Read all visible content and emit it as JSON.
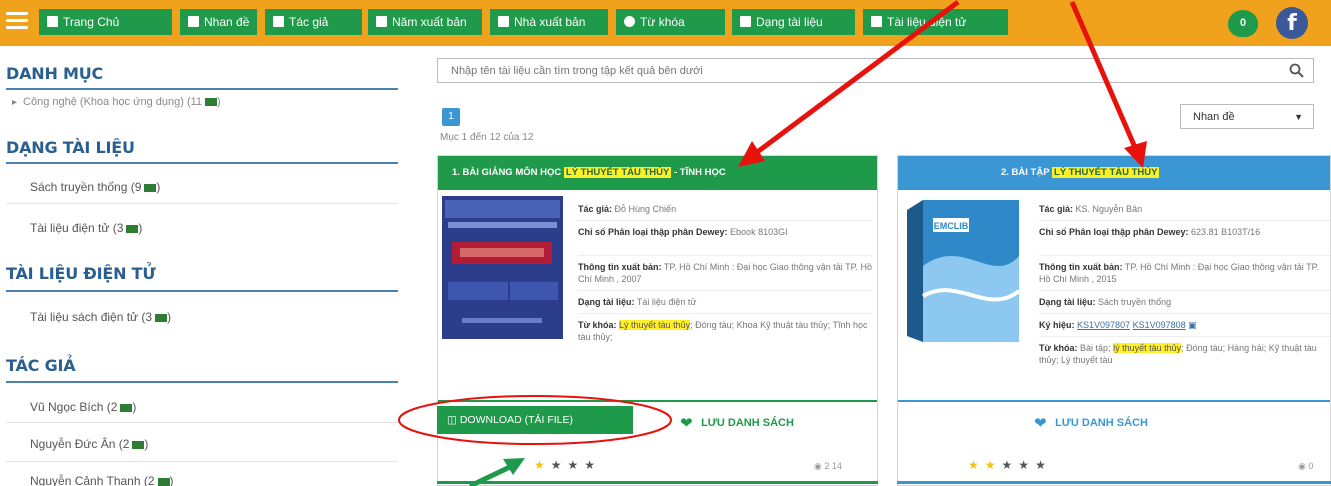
{
  "nav": {
    "items": [
      {
        "label": "Trang Chủ",
        "icon": "home-icon"
      },
      {
        "label": "Nhan đề",
        "icon": "title-icon"
      },
      {
        "label": "Tác giả",
        "icon": "author-icon"
      },
      {
        "label": "Năm xuất bản",
        "icon": "calendar-icon"
      },
      {
        "label": "Nhà xuất bản",
        "icon": "publisher-icon"
      },
      {
        "label": "Từ khóa",
        "icon": "tag-icon"
      },
      {
        "label": "Dạng tài liệu",
        "icon": "doc-type-icon"
      },
      {
        "label": "Tài liệu điện tử",
        "icon": "ebook-icon"
      }
    ],
    "favorites_count": "0",
    "facebook_label": "f"
  },
  "sidebar": {
    "danh_muc_title": "DANH MỤC",
    "danh_muc_item": "Công nghệ (Khoa học ứng dụng) (11",
    "dang_title": "DẠNG TÀI LIỆU",
    "dang_items": [
      "Sách truyền thống (9",
      "Tài liệu điện tử (3"
    ],
    "dien_tu_title": "TÀI LIỆU ĐIỆN TỬ",
    "dien_tu_items": [
      "Tài liệu sách điện tử (3"
    ],
    "tac_gia_title": "TÁC GIẢ",
    "tac_gia_items": [
      "Vũ Ngọc Bích (2",
      "Nguyễn Đức Ân (2",
      "Nguyễn Cảnh Thanh (2"
    ]
  },
  "search": {
    "placeholder": "Nhập tên tài liệu cần tìm trong tập kết quả bên dưới"
  },
  "pagination": {
    "page": "1",
    "range": "Mục 1 đến 12 của 12"
  },
  "sort": {
    "selected": "Nhan đề"
  },
  "card1": {
    "title_prefix": "1. BÀI GIẢNG MÔN HỌC ",
    "title_highlight": "LÝ THUYẾT TÀU THỦY",
    "title_suffix": " - TĨNH HỌC",
    "author_label": "Tác giả:",
    "author": "Đỗ Hùng Chiến",
    "dewey_label": "Chỉ số Phân loại thập phân Dewey:",
    "dewey": "Ebook 8103GI",
    "pub_label": "Thông tin xuất bản:",
    "pub": "TP. Hồ Chí Minh : Đại học Giao thông vận tải TP. Hồ Chí Minh , 2007",
    "type_label": "Dạng tài liệu:",
    "type": "Tài liệu điện tử",
    "kw_label": "Từ khóa:",
    "kw_highlight": "Lý thuyết tàu thủy",
    "kw_rest": "; Đóng tàu; Khoa Kỹ thuật tàu thủy; Tĩnh học tàu thủy;",
    "download": "DOWNLOAD (TẢI FILE)",
    "save": "LƯU DANH SÁCH",
    "rating": 1,
    "stats": "2 14"
  },
  "card2": {
    "title_prefix": "2. BÀI TẬP ",
    "title_highlight": "LÝ THUYẾT TÀU THỦY",
    "author_label": "Tác giả:",
    "author": "KS. Nguyễn Bân",
    "dewey_label": "Chỉ số Phân loại thập phân Dewey:",
    "dewey": "623.81 B103T/16",
    "pub_label": "Thông tin xuất bản:",
    "pub": "TP. Hồ Chí Minh : Đại học Giao thông vận tải TP. Hồ Chí Minh , 2015",
    "type_label": "Dạng tài liệu:",
    "type": "Sách truyền thống",
    "code_label": "Ký hiệu:",
    "code1": "KS1V097807",
    "code2": "KS1V097808",
    "kw_label": "Từ khóa:",
    "kw_pre": "Bài tập;",
    "kw_highlight": "lý thuyết tàu thủy",
    "kw_rest": "; Đóng tàu; Hàng hải; Kỹ thuật tàu thủy; Lý thuyết tàu",
    "save": "LƯU DANH SÁCH",
    "cover_brand": "EMCLIB",
    "rating": 2,
    "stats": "0"
  },
  "colors": {
    "nav_bg": "#f0a21c",
    "green": "#1f9a4a",
    "blue": "#3b97d3",
    "highlight": "#ffef26",
    "annotation": "#e8120c"
  }
}
